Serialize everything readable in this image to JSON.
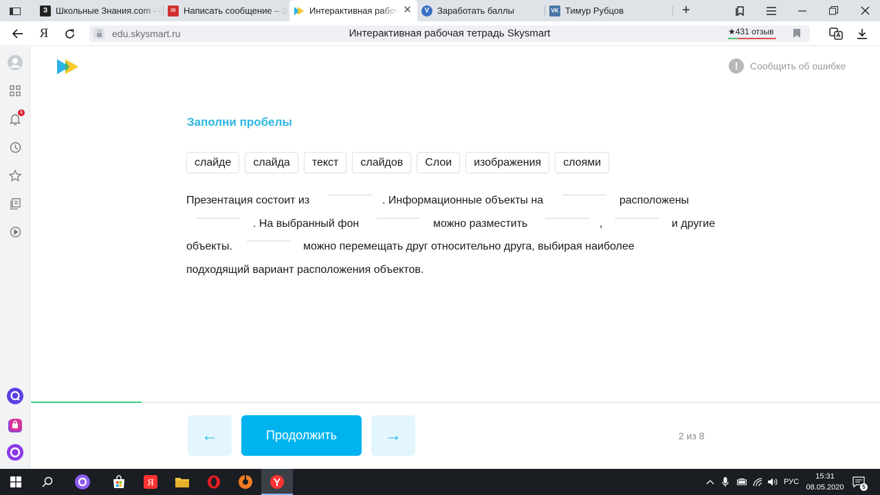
{
  "browser": {
    "tabs": [
      {
        "title": "Школьные Знания.com - Р",
        "favicon": "znania-icon",
        "favicon_color": "#222222",
        "favicon_glyph": "З"
      },
      {
        "title": "Написать сообщение – Э",
        "favicon": "mail-icon",
        "favicon_color": "#d0302f",
        "favicon_glyph": "✉"
      },
      {
        "title": "Интерактивная рабоча",
        "favicon": "skysmart-icon",
        "favicon_color": "#2ab3e6",
        "favicon_glyph": "▶",
        "active": true
      },
      {
        "title": "Заработать баллы",
        "favicon": "v-icon",
        "favicon_color": "#3a6fc4",
        "favicon_glyph": "V"
      },
      {
        "title": "Тимур Рубцов",
        "favicon": "vk-icon",
        "favicon_color": "#4a76a8",
        "favicon_glyph": "VK"
      }
    ],
    "address": {
      "domain": "edu.skysmart.ru",
      "page_title": "Интерактивная рабочая тетрадь Skysmart",
      "reviews": "★431 отзыв"
    }
  },
  "page": {
    "report_error": "Сообщить об ошибке",
    "task_title": "Заполни пробелы",
    "word_bank": [
      "слайде",
      "слайда",
      "текст",
      "слайдов",
      "Слои",
      "изображения",
      "слоями"
    ],
    "text": {
      "l1a": "Презентация состоит из",
      "l1b": ". Информационные объекты на",
      "l1c": "расположены",
      "l2a": ". На выбранный фон",
      "l2b": "можно разместить",
      "l2c": ",",
      "l2d": "и другие",
      "l3a": "объекты.",
      "l3b": "можно перемещать друг относительно друга, выбирая наиболее",
      "l4": "подходящий вариант расположения объектов."
    },
    "progress_fraction": 0.13,
    "continue_label": "Продолжить",
    "prev_arrow": "←",
    "next_arrow": "→",
    "pager": "2 из 8"
  },
  "sidebar": {
    "notification_count": "1"
  },
  "taskbar": {
    "language": "РУС",
    "time": "15:31",
    "date": "08.05.2020",
    "notifications": "5"
  }
}
